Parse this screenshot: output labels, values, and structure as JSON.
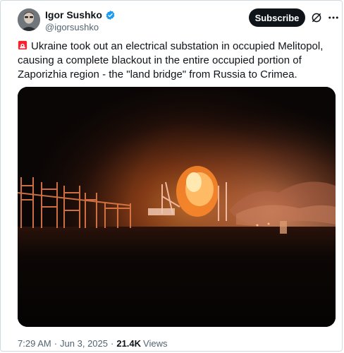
{
  "author": {
    "name": "Igor Sushko",
    "handle": "@igorsushko",
    "verified": true
  },
  "header": {
    "subscribe_label": "Subscribe",
    "grok_icon": "grok-icon",
    "more_icon": "more-icon"
  },
  "tweet": {
    "emoji": "siren-icon",
    "text": "Ukraine took out an electrical substation in occupied Melitopol, causing a complete blackout in the entire occupied portion of Zaporizhia region - the \"land bridge\" from Russia to Crimea."
  },
  "meta": {
    "time": "7:29 AM",
    "date": "Jun 3, 2025",
    "separator": "·",
    "views_count": "21.4K",
    "views_label": "Views"
  },
  "colors": {
    "verified": "#1d9bf0",
    "subscribe_bg": "#0f1419",
    "muted_text": "#536471",
    "siren": "#f4212e"
  }
}
